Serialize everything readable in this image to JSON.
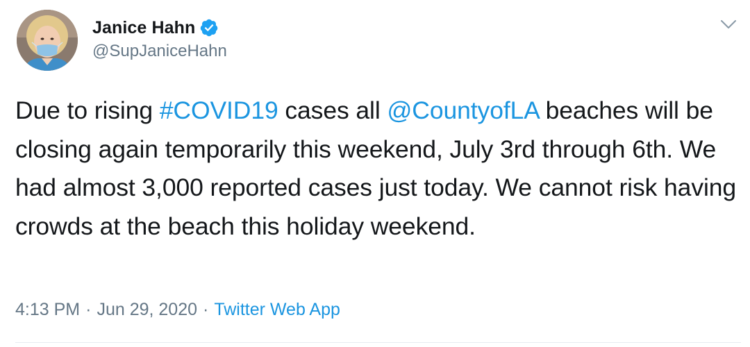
{
  "author": {
    "display_name": "Janice Hahn",
    "handle": "@SupJaniceHahn",
    "verified": true,
    "avatar_icon": "profile-photo"
  },
  "tweet": {
    "text_parts": [
      {
        "text": "Due to rising ",
        "type": "plain"
      },
      {
        "text": "#COVID19",
        "type": "hashtag"
      },
      {
        "text": " cases all ",
        "type": "plain"
      },
      {
        "text": "@CountyofLA",
        "type": "mention"
      },
      {
        "text": " beaches will be closing again temporarily this weekend, July 3rd through 6th. We had almost 3,000 reported cases just today. We cannot risk having crowds at the beach this holiday weekend.",
        "type": "plain"
      }
    ],
    "time": "4:13 PM",
    "date": "Jun 29, 2020",
    "separator": "·",
    "source": "Twitter Web App"
  },
  "icons": {
    "verified": "verified-badge-icon",
    "more": "chevron-down-icon"
  },
  "colors": {
    "link": "#1b95e0",
    "secondary_text": "#657786",
    "primary_text": "#14171a",
    "verified_badge": "#1da1f2",
    "mask": "#8fc3e6"
  }
}
